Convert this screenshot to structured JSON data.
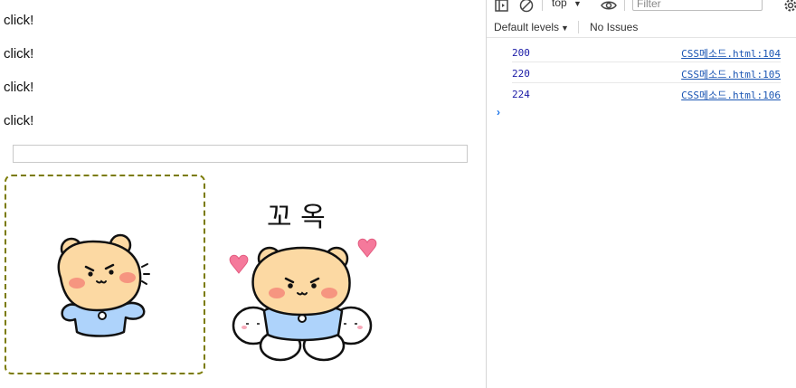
{
  "page": {
    "click_lines": [
      "click!",
      "click!",
      "click!",
      "click!"
    ],
    "input_value": "",
    "sticker_1": "bear-sticker",
    "sticker_2": {
      "icon": "bear-hug-sticker",
      "caption": "꼬 옥"
    }
  },
  "devtools": {
    "toolbar": {
      "context": "top",
      "filter_placeholder": "Filter"
    },
    "levels_label": "Default levels",
    "issues_label": "No Issues",
    "logs": [
      {
        "value": "200",
        "source": "CSS메소드.html:104"
      },
      {
        "value": "220",
        "source": "CSS메소드.html:105"
      },
      {
        "value": "224",
        "source": "CSS메소드.html:106"
      }
    ],
    "prompt": "›"
  },
  "colors": {
    "dashed_border": "#7a7a00",
    "log_value": "#1a1aa6",
    "source_link": "#1a55b3",
    "bear_fur": "#fcd9a3",
    "bear_shirt": "#aed3fb",
    "heart": "#f5799b"
  }
}
